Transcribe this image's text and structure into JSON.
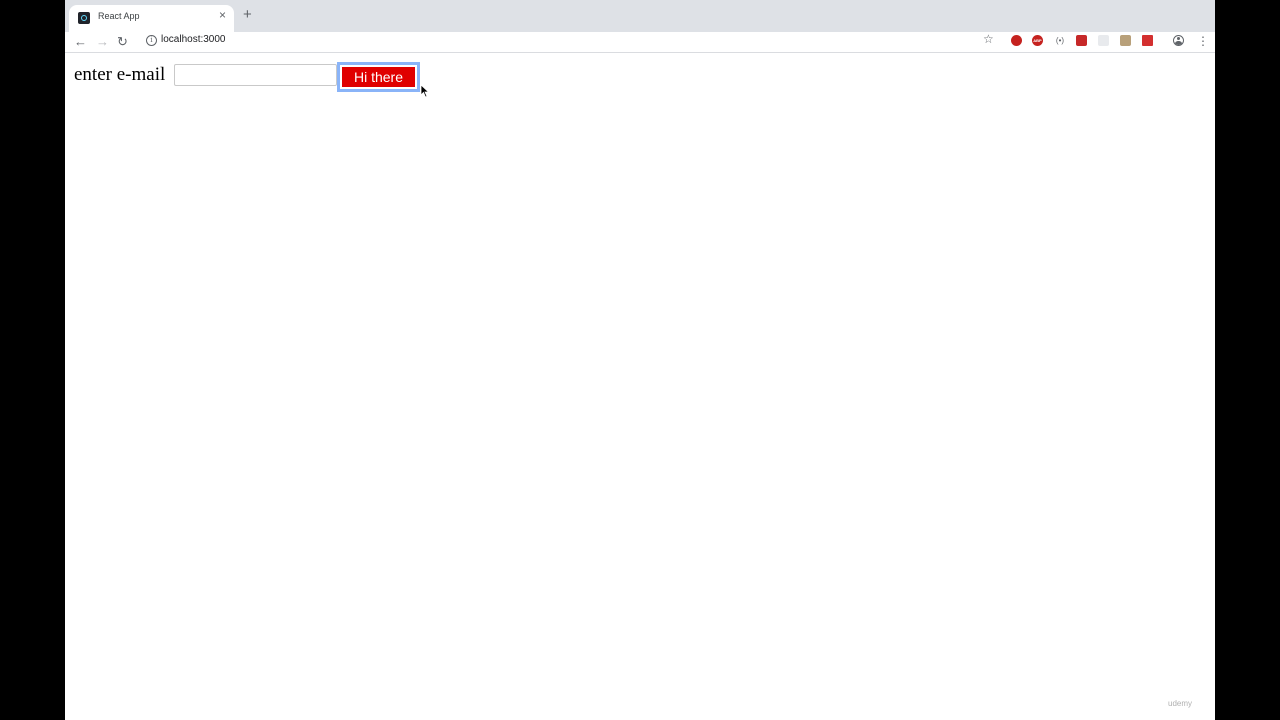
{
  "browser": {
    "tab": {
      "title": "React App",
      "close_glyph": "×",
      "favicon": "react-favicon-icon"
    },
    "new_tab_glyph": "+",
    "nav": {
      "back_glyph": "←",
      "forward_glyph": "→",
      "reload_glyph": "↻"
    },
    "address_bar": {
      "url": "localhost:3000",
      "info_glyph": "i"
    },
    "bookmark_glyph": "☆",
    "menu_glyph": "⋮",
    "extensions": [
      "stop-icon",
      "adblock-plus-icon",
      "wave-icon",
      "extension-red-icon",
      "extension-white-icon",
      "extension-tan-icon",
      "extension-square-red-icon"
    ],
    "ext_abp_text": "ABP",
    "ext_wave_text": "(•)"
  },
  "page": {
    "label": "enter e-mail",
    "input_value": "",
    "button_label": "Hi there",
    "button_color": "#e00000",
    "focus_ring_color": "#8ab4f8"
  },
  "watermark": "udemy"
}
